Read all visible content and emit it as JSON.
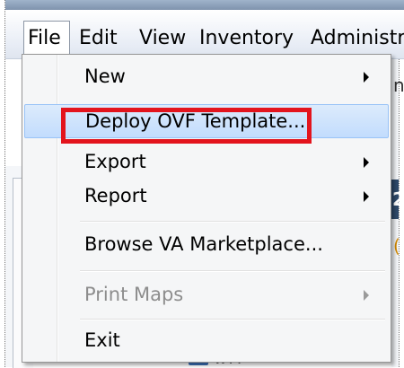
{
  "menubar": {
    "items": [
      {
        "label": "File",
        "active": true
      },
      {
        "label": "Edit",
        "active": false
      },
      {
        "label": "View",
        "active": false
      },
      {
        "label": "Inventory",
        "active": false
      },
      {
        "label": "Administr",
        "active": false
      }
    ]
  },
  "file_menu": {
    "items": [
      {
        "label": "New",
        "submenu": true,
        "enabled": true,
        "highlighted": false
      },
      {
        "label": "Deploy OVF Template...",
        "submenu": false,
        "enabled": true,
        "highlighted": true
      },
      {
        "label": "Export",
        "submenu": true,
        "enabled": true,
        "highlighted": false
      },
      {
        "label": "Report",
        "submenu": true,
        "enabled": true,
        "highlighted": false
      },
      {
        "label": "Browse VA Marketplace...",
        "submenu": false,
        "enabled": true,
        "highlighted": false
      },
      {
        "label": "Print Maps",
        "submenu": true,
        "enabled": false,
        "highlighted": false
      },
      {
        "label": "Exit",
        "submenu": false,
        "enabled": true,
        "highlighted": false
      }
    ]
  },
  "background": {
    "peek_a": "nt",
    "peek_b": "2",
    "peek_c": "(",
    "bottom_text": "w??"
  },
  "colors": {
    "highlight": "#c2dcfd",
    "callout": "#e3141d",
    "disabled_text": "#8d8d8d"
  }
}
